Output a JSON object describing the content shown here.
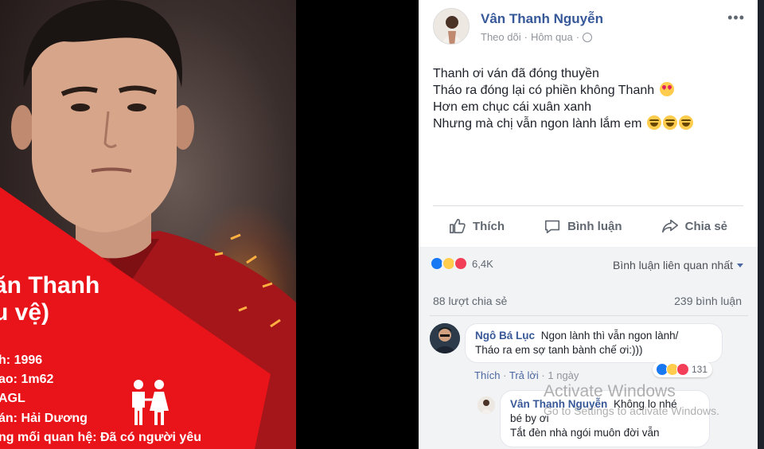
{
  "promo": {
    "name": "ăn Thanh",
    "position": "u vệ)",
    "lines": [
      {
        "label": "h:",
        "value": "1996"
      },
      {
        "label": "ao:",
        "value": "1m62"
      },
      {
        "label": "",
        "value": "AGL"
      },
      {
        "label": "án:",
        "value": "Hải Dương"
      },
      {
        "label": "ng mối quan hệ:",
        "value": "Đã có người yêu"
      }
    ]
  },
  "post": {
    "author": "Vân Thanh Nguyễn",
    "follow": "Theo dõi",
    "dot": "·",
    "time": "Hôm qua",
    "dot2": "·",
    "menu": "•••",
    "lines": [
      "Thanh ơi ván đã đóng thuyền",
      "Tháo ra đóng lại có phiền không Thanh",
      "Hơn em chục cái xuân xanh",
      "Nhưng mà chị vẫn ngon lành lắm em"
    ],
    "actions": {
      "like": "Thích",
      "comment": "Bình luận",
      "share": "Chia sẻ"
    },
    "reaction_count": "6,4K",
    "sort_label": "Bình luận liên quan nhất",
    "shares": "88 lượt chia sẻ",
    "comments_count": "239 bình luận"
  },
  "comment": {
    "author": "Ngô Bá Lục",
    "text1": "Ngon lành thì vẫn ngon lành/",
    "text2": "Tháo ra em sợ tanh bành chế ơi:)))",
    "like": "Thích",
    "reply": "Trả lời",
    "time": "1 ngày",
    "reaction_count": "131"
  },
  "reply": {
    "author": "Vân Thanh Nguyễn",
    "text1": "Không lo nhé",
    "text2": "bé by ơi",
    "text3": "Tắt đèn nhà ngói muôn đời vẫn"
  },
  "watermark": {
    "title": "Activate Windows",
    "subtitle": "Go to Settings to activate Windows."
  },
  "colors": {
    "facebook_blue": "#365899",
    "promo_red": "#e8141a"
  }
}
